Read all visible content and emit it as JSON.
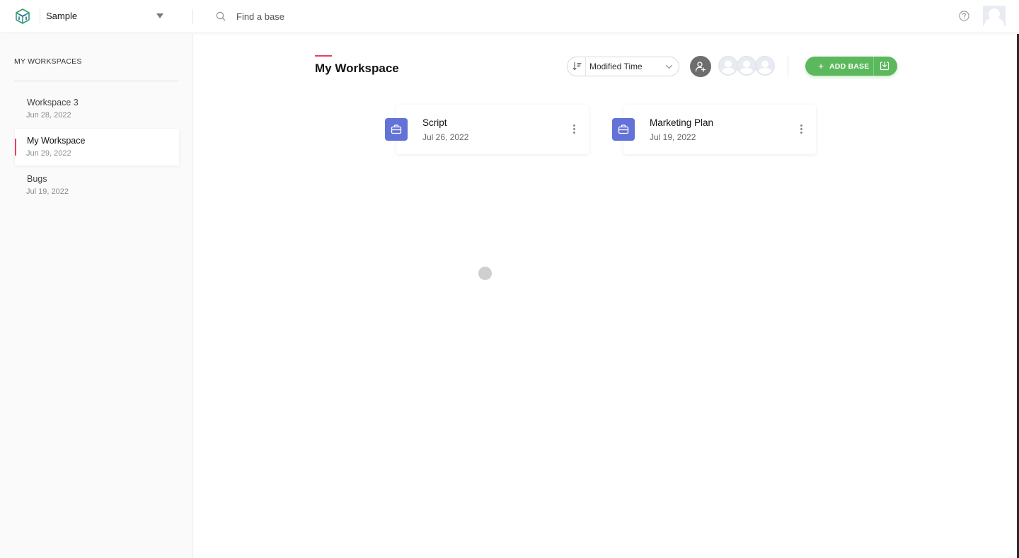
{
  "topbar": {
    "org_name": "Sample",
    "search_placeholder": "Find a base"
  },
  "sidebar": {
    "title": "MY WORKSPACES",
    "items": [
      {
        "name": "Workspace 3",
        "date": "Jun 28, 2022",
        "active": false
      },
      {
        "name": "My Workspace",
        "date": "Jun 29, 2022",
        "active": true
      },
      {
        "name": "Bugs",
        "date": "Jul 19, 2022",
        "active": false
      }
    ]
  },
  "main": {
    "title": "My Workspace",
    "sort": {
      "label": "Modified Time"
    },
    "add_base_label": "ADD BASE",
    "bases": [
      {
        "name": "Script",
        "date": "Jul 26, 2022"
      },
      {
        "name": "Marketing Plan",
        "date": "Jul 19, 2022"
      }
    ]
  },
  "colors": {
    "accent_red": "#e8415b",
    "primary_green": "#5cb85c",
    "base_icon_blue": "#6272d6"
  },
  "icons": {
    "logo": "cube-logo-icon",
    "search": "search-icon",
    "help": "help-icon",
    "sort": "sort-icon",
    "add_user": "add-user-icon",
    "import": "import-icon",
    "base": "briefcase-icon",
    "menu": "more-vertical-icon"
  }
}
